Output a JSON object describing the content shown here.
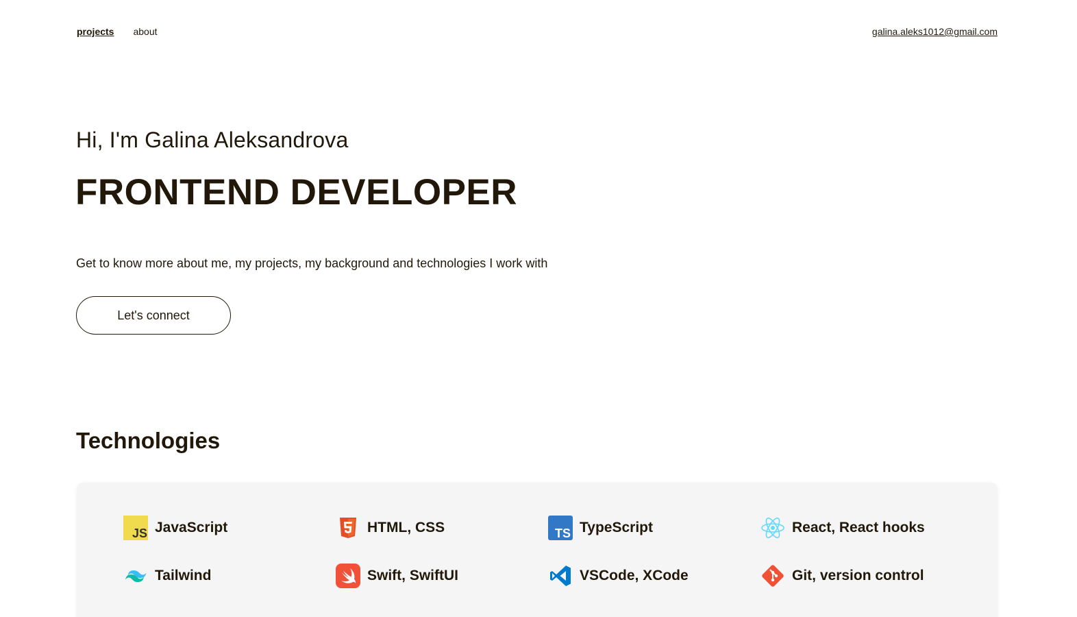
{
  "nav": {
    "links": [
      {
        "label": "projects",
        "active": true
      },
      {
        "label": "about",
        "active": false
      }
    ],
    "email": "galina.aleks1012@gmail.com"
  },
  "hero": {
    "greeting": "Hi, I'm Galina Aleksandrova",
    "role": "FRONTEND DEVELOPER",
    "tagline": "Get to know more about me, my projects, my background and technologies I work with",
    "cta_label": "Let's connect"
  },
  "technologies": {
    "heading": "Technologies",
    "items": [
      {
        "label": "JavaScript",
        "icon": "javascript-icon"
      },
      {
        "label": "HTML, CSS",
        "icon": "html5-icon"
      },
      {
        "label": "TypeScript",
        "icon": "typescript-icon"
      },
      {
        "label": "React, React hooks",
        "icon": "react-icon"
      },
      {
        "label": "Tailwind",
        "icon": "tailwind-icon"
      },
      {
        "label": "Swift, SwiftUI",
        "icon": "swift-icon"
      },
      {
        "label": "VSCode, XCode",
        "icon": "vscode-icon"
      },
      {
        "label": "Git, version control",
        "icon": "git-icon"
      }
    ]
  },
  "colors": {
    "text": "#21180a",
    "panel_bg": "#f5f5f5",
    "javascript": "#f0db4f",
    "html5": "#e44d26",
    "typescript": "#3178c6",
    "react": "#61dafb",
    "tailwind": "#38bdf8",
    "swift": "#f05138",
    "vscode": "#007acc",
    "git": "#f05033"
  }
}
